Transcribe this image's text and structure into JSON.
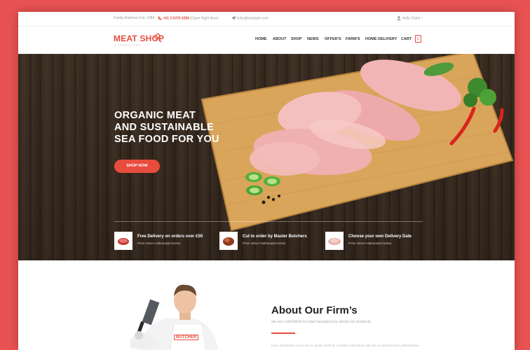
{
  "topbar": {
    "tagline": "Family Butchers Est. 1969",
    "phone": "+61 3 6376 6284",
    "hours": "(Open Right Now)",
    "email": "hello@example.com",
    "greeting": "Hello Visitor !"
  },
  "brand": {
    "name": "MEAT SHOP",
    "sub": "& CHARCUTERIE",
    "logo_icon": "cleaver-logo-icon"
  },
  "nav": [
    "HOME",
    "ABOUT",
    "SHOP",
    "NEWS",
    "OFFER'S",
    "FARM'S",
    "HOME DELIVERY",
    "CART"
  ],
  "cart_count": "0",
  "hero": {
    "title_lines": [
      "ORGANIC MEAT",
      "AND  SUSTAINABLE",
      "SEA FOOD FOR YOU"
    ],
    "button": "SHOP NOW"
  },
  "features": [
    {
      "title": "Free Delivery on orders over £50",
      "sub": "Proin varius malesuada lacinia.",
      "icon": "meat-icon"
    },
    {
      "title": "Cut to order by Master Butchers",
      "sub": "Proin varius malesuada lacinia.",
      "icon": "roast-icon"
    },
    {
      "title": "Choose your own Delivery Date",
      "sub": "Proin varius malesuada lacinia.",
      "icon": "ham-icon"
    }
  ],
  "about": {
    "title": "About Our Firm’s",
    "subtitle": "we are committed to total transparency about our products.",
    "body": "Nunc elementum purus vel ex iaculis eleifend. Curabitur bibendum odio dui, et placerat enim pellentesque"
  },
  "butcher_apron": "BUTCHER",
  "colors": {
    "accent": "#e84c3d",
    "background": "#e85252"
  }
}
